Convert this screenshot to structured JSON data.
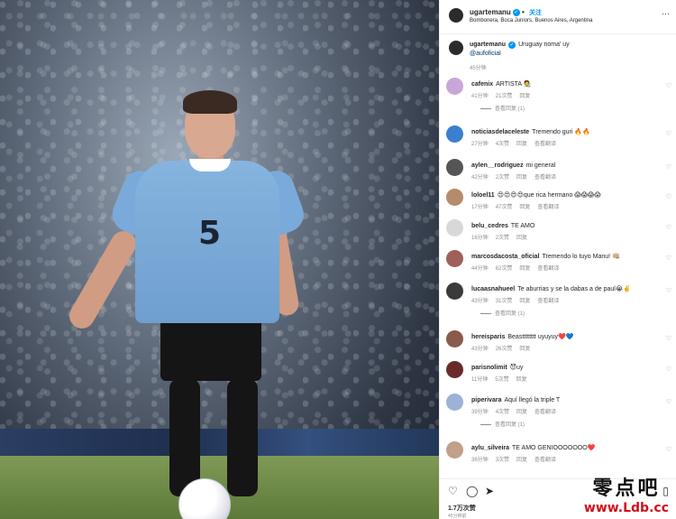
{
  "post": {
    "username": "ugartemanu",
    "follow_label": "关注",
    "location": "Bombonera, Boca Juniors, Buenos Aires, Argentina",
    "caption_user": "ugartemanu",
    "caption_text": "Uruguay noma' uy",
    "caption_tag": "@aufoficial",
    "caption_time": "45分钟",
    "jersey_number": "5",
    "likes": "1.7万次赞",
    "post_time": "45分钟前"
  },
  "comments": [
    {
      "user": "cafenix",
      "text": "ARTISTA 🧑‍🎨",
      "time": "41分钟",
      "likes": "21次赞",
      "reply": "回复",
      "translate": "",
      "replies": "查看回复 (1)"
    },
    {
      "user": "noticiasdelaceleste",
      "text": "Tremendo guri 🔥🔥",
      "time": "27分钟",
      "likes": "4次赞",
      "reply": "回复",
      "translate": "查看翻译",
      "replies": ""
    },
    {
      "user": "aylen__rodriguez",
      "text": "mi general",
      "time": "42分钟",
      "likes": "2次赞",
      "reply": "回复",
      "translate": "查看翻译",
      "replies": ""
    },
    {
      "user": "loloel11",
      "text": "😍😍😍😍que rica hermano 😱😱😱😱",
      "time": "17分钟",
      "likes": "47次赞",
      "reply": "回复",
      "translate": "查看翻译",
      "replies": ""
    },
    {
      "user": "belu_cedres",
      "text": "TE AMO",
      "time": "16分钟",
      "likes": "2次赞",
      "reply": "回复",
      "translate": "",
      "replies": ""
    },
    {
      "user": "marcosdacosta_oficial",
      "text": "Tremendo lo tuyo Manu! 👊🏼",
      "time": "44分钟",
      "likes": "62次赞",
      "reply": "回复",
      "translate": "查看翻译",
      "replies": ""
    },
    {
      "user": "lucaasnahueel",
      "text": "Te aburrias y se la dabas a de paul😭✌️",
      "time": "43分钟",
      "likes": "31次赞",
      "reply": "回复",
      "translate": "查看翻译",
      "replies": "查看回复 (1)"
    },
    {
      "user": "hereisparis",
      "text": "Beastttttttt uyuyuy❤️💙",
      "time": "43分钟",
      "likes": "26次赞",
      "reply": "回复",
      "translate": "",
      "replies": ""
    },
    {
      "user": "parisnolimit",
      "text": "😈uy",
      "time": "11分钟",
      "likes": "5次赞",
      "reply": "回复",
      "translate": "",
      "replies": ""
    },
    {
      "user": "piperivara",
      "text": "Aquí llegó la triple T",
      "time": "39分钟",
      "likes": "4次赞",
      "reply": "回复",
      "translate": "查看翻译",
      "replies": "查看回复 (1)"
    },
    {
      "user": "aylu_silveira",
      "text": "TE AMO GENIOOOOOOO❤️",
      "time": "36分钟",
      "likes": "3次赞",
      "reply": "回复",
      "translate": "查看翻译",
      "replies": ""
    }
  ],
  "icons": {
    "like": "heart-icon",
    "comment": "comment-icon",
    "share": "share-icon",
    "save": "bookmark-icon"
  },
  "watermark": {
    "line1": "零点吧",
    "line2": "www.Ldb.cc"
  }
}
